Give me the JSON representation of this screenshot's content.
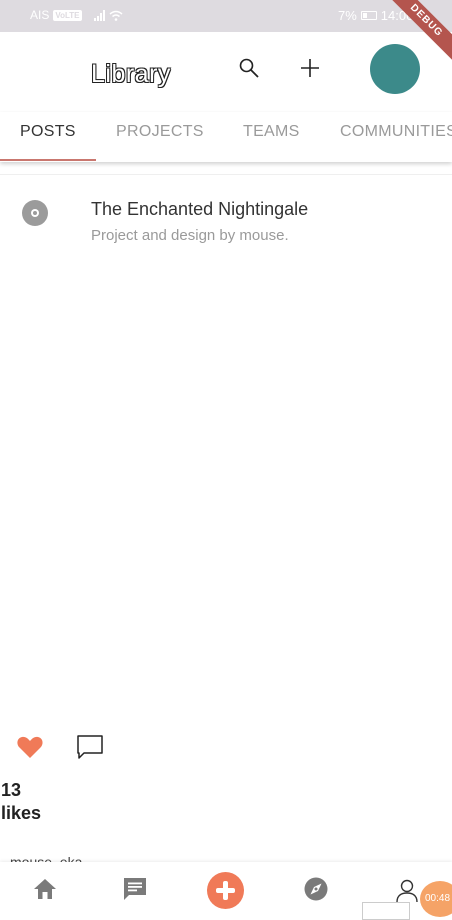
{
  "status_bar": {
    "carrier": "AIS",
    "network_badge": "VoLTE",
    "battery": "7%",
    "time": "14:00"
  },
  "debug_banner": "DEBUG",
  "app_bar": {
    "title": "Library",
    "search_icon": "search-icon",
    "add_icon": "plus-icon",
    "avatar_color": "#3c8a8a"
  },
  "tabs": [
    {
      "label": "POSTS",
      "active": true
    },
    {
      "label": "PROJECTS",
      "active": false
    },
    {
      "label": "TEAMS",
      "active": false
    },
    {
      "label": "COMMUNITIES",
      "active": false
    }
  ],
  "list": {
    "items": [
      {
        "title": "The Enchanted Nightingale",
        "subtitle": "Project and design by mouse.",
        "icon": "disc-icon"
      }
    ]
  },
  "post_actions": {
    "like_icon": "heart-icon",
    "comment_icon": "comment-icon",
    "likes_text": "13 likes",
    "author": "mouse_eka"
  },
  "bottom_nav": {
    "items": [
      "home-icon",
      "chat-icon",
      "add-icon",
      "explore-icon",
      "profile-icon"
    ]
  },
  "overlay": {
    "timer": "00:48"
  },
  "colors": {
    "accent": "#f07a58",
    "tab_indicator": "#c9776f",
    "status_bar": "#dedbe0"
  }
}
